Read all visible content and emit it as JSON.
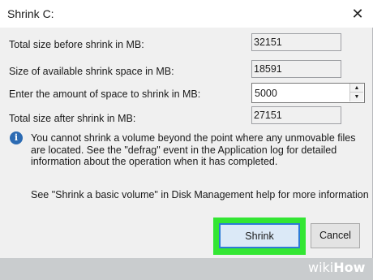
{
  "window": {
    "title": "Shrink C:",
    "close_glyph": "✕"
  },
  "fields": [
    {
      "label": "Total size before shrink in MB:",
      "value": "32151"
    },
    {
      "label": "Size of available shrink space in MB:",
      "value": "18591"
    },
    {
      "label": "Enter the amount of space to shrink in MB:",
      "value": "5000"
    },
    {
      "label": "Total size after shrink in MB:",
      "value": "27151"
    }
  ],
  "info": {
    "icon": "info-icon",
    "text": "You cannot shrink a volume beyond the point where any unmovable files are located. See the \"defrag\" event in the Application log for detailed information about the operation when it has completed.",
    "help": "See \"Shrink a basic volume\" in Disk Management help for more information"
  },
  "buttons": {
    "shrink": "Shrink",
    "cancel": "Cancel"
  },
  "watermark": {
    "wiki": "wiki",
    "how": "How"
  },
  "colors": {
    "highlight": "#33e633",
    "accent": "#2c7bd6",
    "info": "#2c6bb3"
  }
}
